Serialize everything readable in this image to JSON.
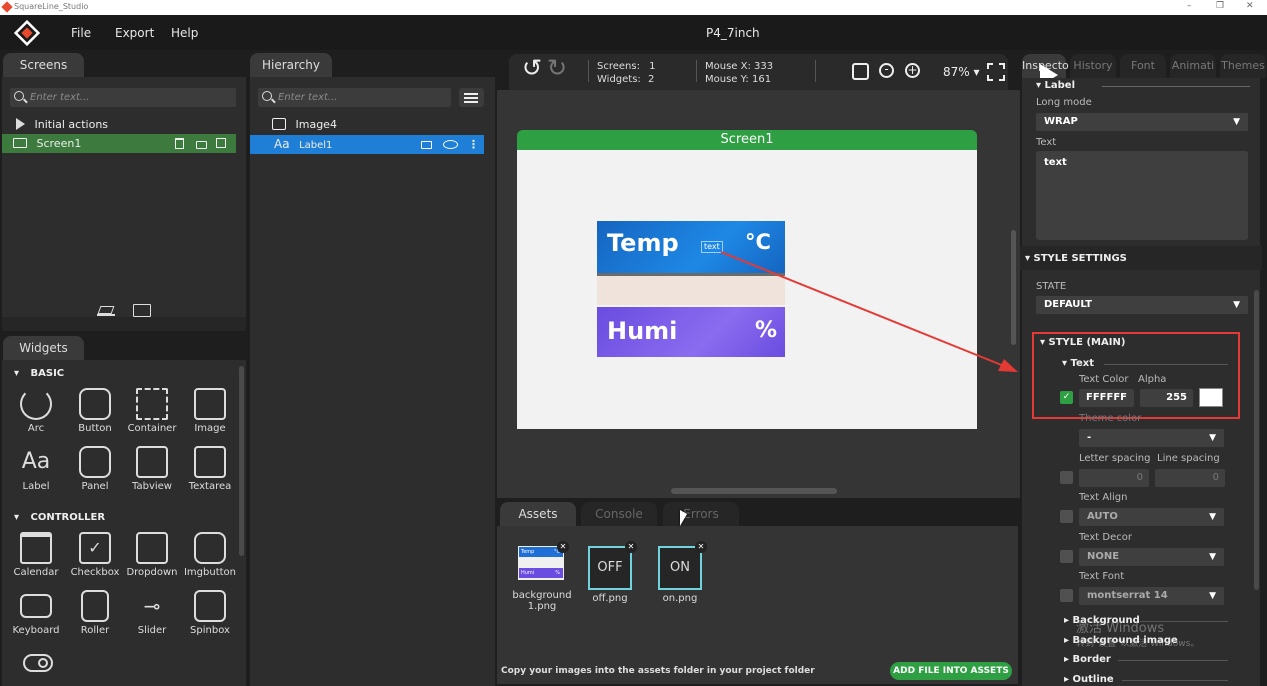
{
  "window": {
    "title": "SquareLine_Studio",
    "minimize": "–",
    "maximize": "❐",
    "close": "✕"
  },
  "menu": {
    "file": "File",
    "export": "Export",
    "help": "Help",
    "project": "P4_7inch"
  },
  "screens_panel": {
    "tab": "Screens",
    "search_placeholder": "Enter text...",
    "items": [
      {
        "label": "Initial actions"
      },
      {
        "label": "Screen1"
      }
    ]
  },
  "hierarchy_panel": {
    "tab": "Hierarchy",
    "search_placeholder": "Enter text...",
    "items": [
      {
        "label": "Image4"
      },
      {
        "label": "Label1",
        "icon": "Aa"
      }
    ]
  },
  "widgets_panel": {
    "tab": "Widgets",
    "basic_header": "BASIC",
    "basic": [
      "Arc",
      "Button",
      "Container",
      "Image",
      "Label",
      "Panel",
      "Tabview",
      "Textarea"
    ],
    "controller_header": "CONTROLLER",
    "controller": [
      "Calendar",
      "Checkbox",
      "Dropdown",
      "Imgbutton",
      "Keyboard",
      "Roller",
      "Slider",
      "Spinbox"
    ]
  },
  "toolbar": {
    "screens_label": "Screens:",
    "screens_value": "1",
    "widgets_label": "Widgets:",
    "widgets_value": "2",
    "mousex_label": "Mouse X:",
    "mousex_value": "333",
    "mousey_label": "Mouse Y:",
    "mousey_value": "161",
    "zoom": "87%"
  },
  "canvas": {
    "screen_title": "Screen1",
    "temp_label": "Temp",
    "temp_unit": "°C",
    "label1_text": "text",
    "humi_label": "Humi",
    "humi_unit": "%"
  },
  "bottom_panel": {
    "tabs": [
      "Assets",
      "Console",
      "Errors"
    ],
    "assets": [
      {
        "name": "background1.png",
        "thumb_temp": "Temp",
        "thumb_unit1": "°C",
        "thumb_humi": "Humi",
        "thumb_unit2": "%"
      },
      {
        "name": "off.png",
        "thumb_text": "OFF"
      },
      {
        "name": "on.png",
        "thumb_text": "ON"
      }
    ],
    "hint": "Copy your images into the assets folder in your project folder",
    "add_button": "ADD FILE INTO ASSETS"
  },
  "inspector": {
    "tabs": [
      "Inspecto",
      "History",
      "Font",
      "Animati",
      "Themes"
    ],
    "label_section": "Label",
    "long_mode_label": "Long mode",
    "long_mode_value": "WRAP",
    "text_label": "Text",
    "text_value": "text",
    "style_settings": "STYLE SETTINGS",
    "state_label": "STATE",
    "state_value": "DEFAULT",
    "style_main": "STYLE (MAIN)",
    "text_sub": "Text",
    "text_color_label": "Text Color",
    "alpha_label": "Alpha",
    "text_color_value": "FFFFFF",
    "alpha_value": "255",
    "theme_color_label": "Theme color",
    "theme_color_value": "-",
    "letter_spacing_label": "Letter spacing",
    "line_spacing_label": "Line spacing",
    "letter_spacing_value": "0",
    "line_spacing_value": "0",
    "text_align_label": "Text Align",
    "text_align_value": "AUTO",
    "text_decor_label": "Text Decor",
    "text_decor_value": "NONE",
    "text_font_label": "Text Font",
    "text_font_value": "montserrat 14",
    "background": "Background",
    "background_image": "Background image",
    "border": "Border",
    "outline": "Outline",
    "watermark1": "激活 Windows",
    "watermark2": "转到\"设置\"以激活 Windows。"
  },
  "colors": {
    "accent_blue": "#1f7fd6",
    "screen_green": "#2ea043",
    "selected_green": "#3d7a3d",
    "highlight_red": "#e53935"
  }
}
